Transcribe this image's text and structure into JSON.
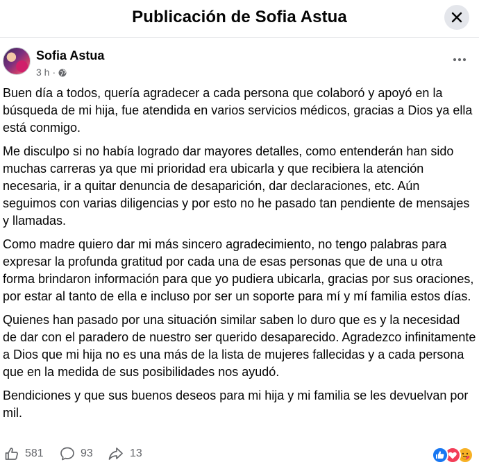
{
  "header": {
    "title": "Publicación de Sofia Astua"
  },
  "post": {
    "author": "Sofia Astua",
    "time": "3 h",
    "separator": "·",
    "privacy_icon": "globe-icon",
    "paragraphs": [
      "Buen día a todos, quería agradecer a cada persona que colaboró y apoyó en la búsqueda de mi hija, fue atendida en varios servicios médicos, gracias a Dios ya ella está conmigo.",
      "Me disculpo si no había logrado dar mayores detalles, como entenderán han sido muchas carreras ya que mi prioridad era ubicarla y que recibiera la atención necesaria, ir a quitar denuncia de desaparición, dar declaraciones, etc. Aún seguimos con varias diligencias y por esto no he pasado tan pendiente de mensajes y llamadas.",
      "Como madre quiero dar mi más sincero agradecimiento, no tengo palabras para expresar la profunda gratitud por cada una de esas personas que de una u otra forma brindaron información para que yo pudiera ubicarla, gracias por sus oraciones, por estar al tanto de ella e incluso por ser un soporte para mí y mí familia estos días.",
      "Quienes han pasado por una situación similar saben lo duro que es y la necesidad de dar con el paradero de nuestro ser querido desaparecido. Agradezco infinitamente a Dios que mi hija no es una más de la lista de mujeres fallecidas y a cada persona que en la medida de sus posibilidades nos ayudó.",
      "Bendiciones y que sus buenos deseos para mi hija y mi familia se les devuelvan por mil."
    ]
  },
  "actions": {
    "likes": "581",
    "comments": "93",
    "shares": "13"
  },
  "reactions": [
    "like-reaction-icon",
    "love-reaction-icon",
    "care-reaction-icon"
  ],
  "colors": {
    "like_blue": "#1877f2",
    "love_red": "#f33e58",
    "care_yellow": "#f7b125",
    "secondary_text": "#65676b"
  }
}
